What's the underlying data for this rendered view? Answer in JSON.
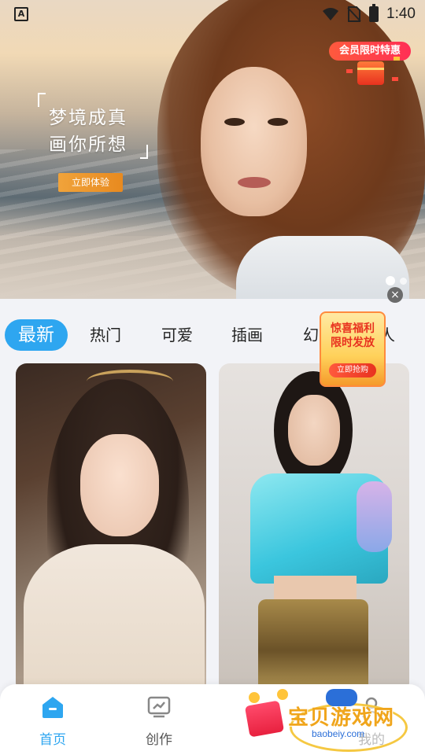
{
  "status_bar": {
    "left_badge": "A",
    "time": "1:40",
    "icons": [
      "wifi-icon",
      "no-sim-icon",
      "battery-charging-icon"
    ]
  },
  "banner": {
    "slogan_line1": "梦境成真",
    "slogan_line2": "画你所想",
    "try_button": "立即体验",
    "vip_badge": "会员限时特惠",
    "carousel": {
      "current": 1,
      "total": 2
    }
  },
  "close_icon": "×",
  "tabs": [
    {
      "label": "最新",
      "active": true
    },
    {
      "label": "热门",
      "active": false
    },
    {
      "label": "可爱",
      "active": false
    },
    {
      "label": "插画",
      "active": false
    },
    {
      "label": "幻",
      "active": false
    },
    {
      "label": "人",
      "active": false
    }
  ],
  "promo": {
    "line1": "惊喜福利",
    "line2": "限时发放",
    "button": "立即抢购"
  },
  "gallery": [
    {
      "name": "girl-portrait-1"
    },
    {
      "name": "girl-portrait-2"
    }
  ],
  "bottom_nav": {
    "home": "首页",
    "create": "创作",
    "mine": "我的"
  },
  "watermark": {
    "brand": "宝贝游戏网",
    "url": "baobeiy.com"
  },
  "colors": {
    "accent": "#2ea6f0",
    "promo_red": "#e8321f",
    "try_orange": "#e88a1f"
  }
}
